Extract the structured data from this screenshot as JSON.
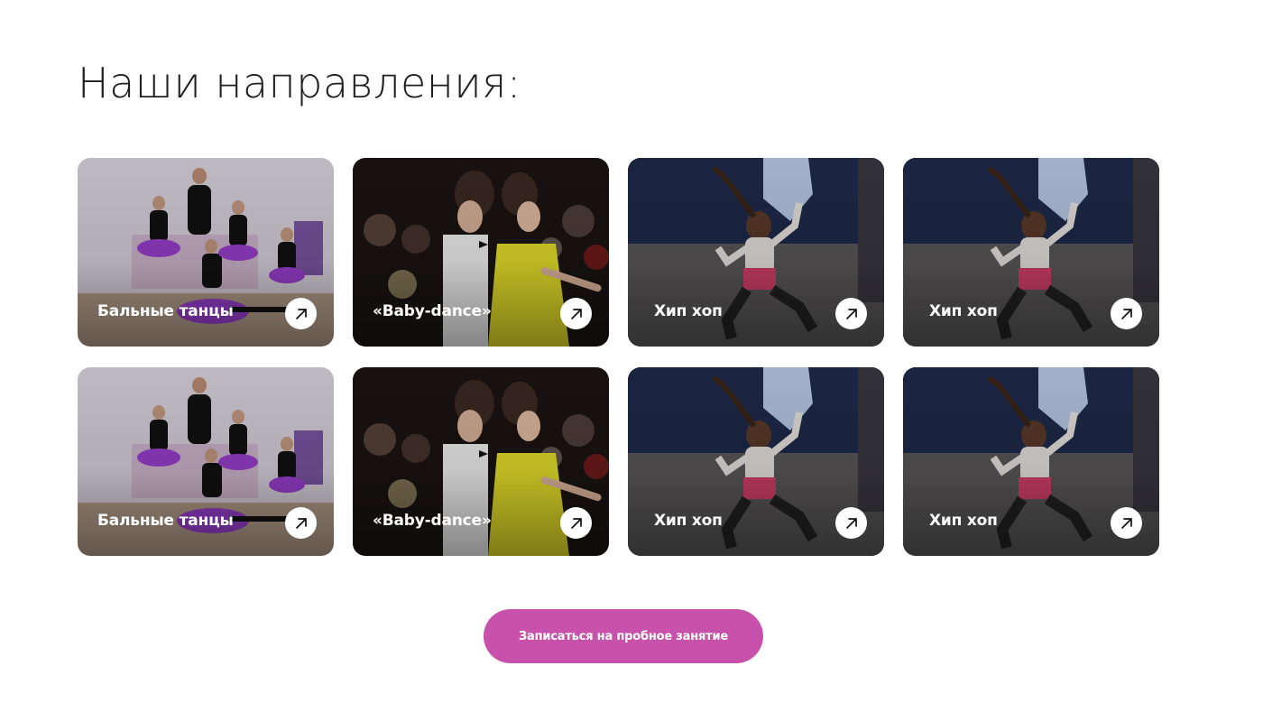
{
  "section": {
    "title": "Наши направления:"
  },
  "cards": [
    {
      "label": "Бальные танцы",
      "photo": "ballet-kids",
      "icon": "arrow-up-right-icon"
    },
    {
      "label": "«Baby-dance»",
      "photo": "ballroom-couple",
      "icon": "arrow-up-right-icon"
    },
    {
      "label": "Хип хоп",
      "photo": "hiphop-girl",
      "icon": "arrow-up-right-icon"
    },
    {
      "label": "Хип хоп",
      "photo": "hiphop-girl",
      "icon": "arrow-up-right-icon"
    },
    {
      "label": "Бальные танцы",
      "photo": "ballet-kids",
      "icon": "arrow-up-right-icon"
    },
    {
      "label": "«Baby-dance»",
      "photo": "ballroom-couple",
      "icon": "arrow-up-right-icon"
    },
    {
      "label": "Хип хоп",
      "photo": "hiphop-girl",
      "icon": "arrow-up-right-icon"
    },
    {
      "label": "Хип хоп",
      "photo": "hiphop-girl",
      "icon": "arrow-up-right-icon"
    }
  ],
  "cta": {
    "label": "Записаться на пробное занятие"
  },
  "colors": {
    "accent": "#c852ab",
    "title": "#1e1e1e",
    "card_text": "#ffffff"
  }
}
